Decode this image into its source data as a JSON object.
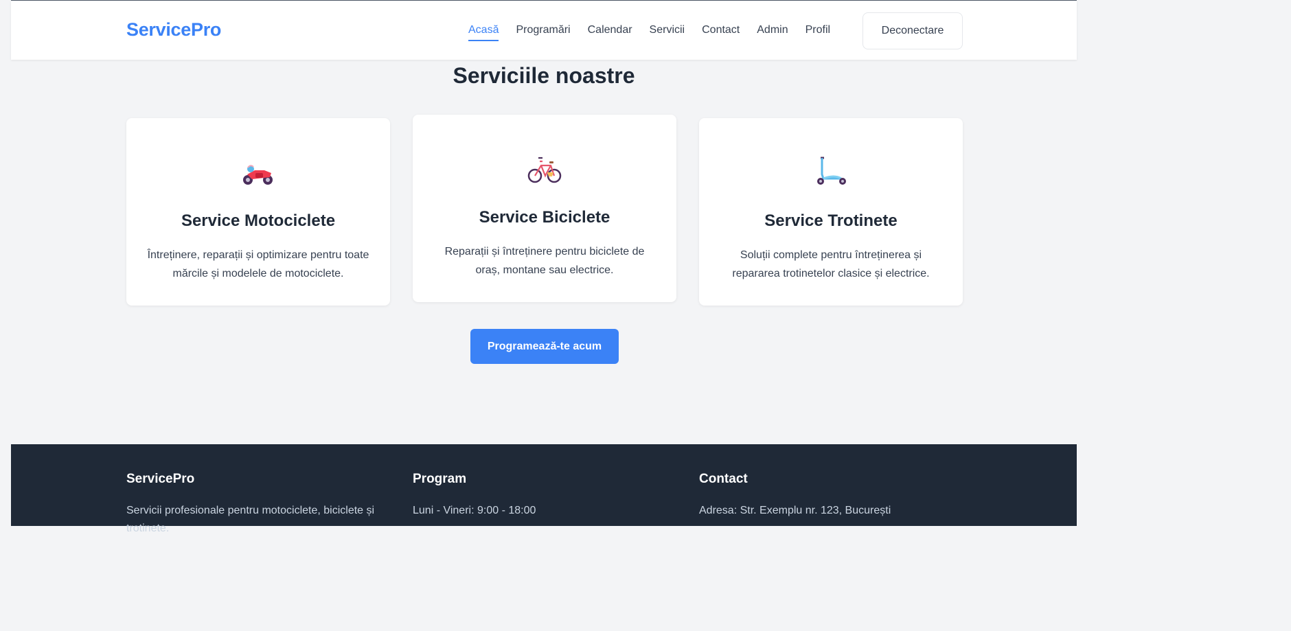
{
  "header": {
    "logo": "ServicePro",
    "nav": [
      {
        "label": "Acasă",
        "active": true
      },
      {
        "label": "Programări"
      },
      {
        "label": "Calendar"
      },
      {
        "label": "Servicii"
      },
      {
        "label": "Contact"
      },
      {
        "label": "Admin"
      },
      {
        "label": "Profil"
      }
    ],
    "logout_label": "Deconectare"
  },
  "main": {
    "title": "Serviciile noastre",
    "cards": [
      {
        "icon": "motorcycle-icon",
        "title": "Service Motociclete",
        "text": "Întreținere, reparații și optimizare pentru toate mărcile și modelele de motociclete."
      },
      {
        "icon": "bicycle-icon",
        "title": "Service Biciclete",
        "text": "Reparații și întreținere pentru biciclete de oraș, montane sau electrice."
      },
      {
        "icon": "scooter-icon",
        "title": "Service Trotinete",
        "text": "Soluții complete pentru întreținerea și repararea trotinetelor clasice și electrice."
      }
    ],
    "cta_label": "Programează-te acum"
  },
  "footer": {
    "about": {
      "title": "ServicePro",
      "text": "Servicii profesionale pentru motociclete, biciclete și trotinete."
    },
    "program": {
      "title": "Program",
      "text": "Luni - Vineri: 9:00 - 18:00"
    },
    "contact": {
      "title": "Contact",
      "text": "Adresa: Str. Exemplu nr. 123, București"
    }
  },
  "colors": {
    "accent": "#3b82f6",
    "footer_bg": "#1f2937",
    "page_bg": "#f3f4f6"
  }
}
